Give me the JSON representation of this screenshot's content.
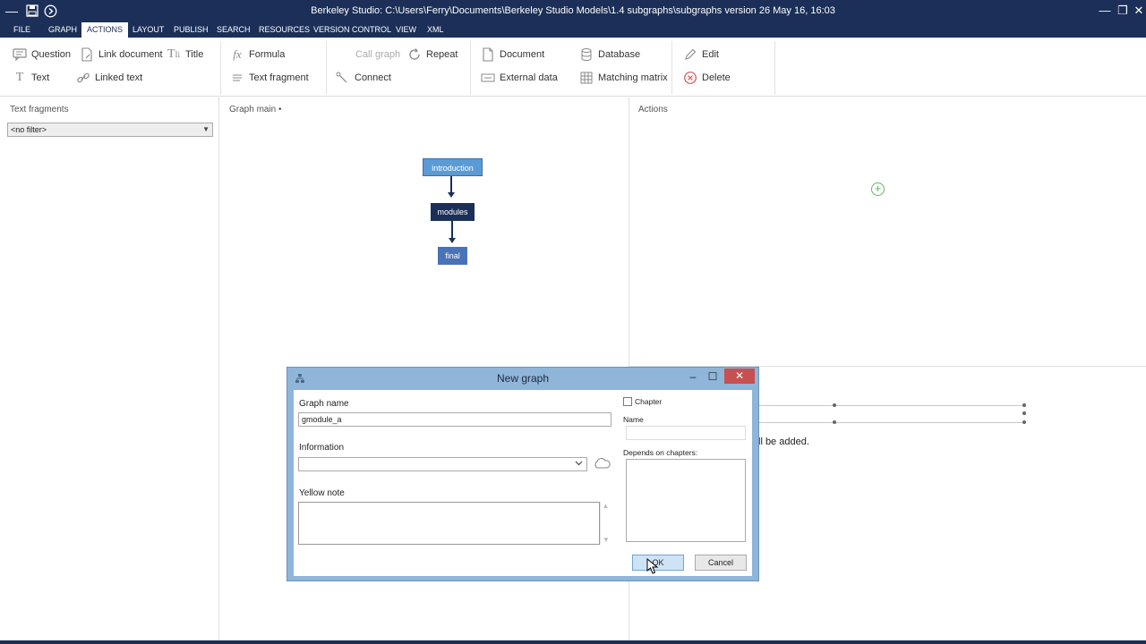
{
  "window": {
    "title": "Berkeley Studio: C:\\Users\\Ferry\\Documents\\Berkeley Studio Models\\1.4 subgraphs\\subgraphs version 26 May 16, 16:03",
    "controls": {
      "minimize": "—",
      "restore": "❐",
      "close": "✕"
    }
  },
  "quick_access": {
    "menu": "—",
    "save": "💾",
    "forward": "⊳"
  },
  "menu": {
    "tabs": [
      "FILE",
      "GRAPH",
      "ACTIONS",
      "LAYOUT",
      "PUBLISH",
      "SEARCH",
      "RESOURCES",
      "VERSION CONTROL",
      "VIEW",
      "XML"
    ],
    "active": "ACTIONS"
  },
  "ribbon": {
    "question": "Question",
    "link_document": "Link document",
    "title": "Title",
    "text": "Text",
    "linked_text": "Linked text",
    "formula": "Formula",
    "text_fragment": "Text fragment",
    "call_graph": "Call graph",
    "repeat": "Repeat",
    "connect": "Connect",
    "document": "Document",
    "database": "Database",
    "external_data": "External data",
    "matching_matrix": "Matching matrix",
    "edit": "Edit",
    "delete": "Delete"
  },
  "left_panel": {
    "title": "Text fragments",
    "filter_value": "<no filter>"
  },
  "graph_panel": {
    "title": "Graph main •",
    "nodes": {
      "introduction": "introduction",
      "modules": "modules",
      "final": "final"
    }
  },
  "actions_panel": {
    "title": "Actions",
    "add_symbol": "+"
  },
  "background_text": "ll be added.",
  "dialog": {
    "title": "New graph",
    "controls": {
      "minimize": "–",
      "maximize": "☐",
      "close": "✕"
    },
    "graph_name_label": "Graph name",
    "graph_name_value": "gmodule_a",
    "information_label": "Information",
    "information_value": "",
    "yellow_note_label": "Yellow note",
    "yellow_note_value": "",
    "chapter_label": "Chapter",
    "chapter_checked": false,
    "name_label": "Name",
    "name_value": "",
    "depends_label": "Depends on chapters:",
    "ok_label": "OK",
    "cancel_label": "Cancel"
  },
  "colors": {
    "titlebar": "#1b2f58",
    "node_introduction": "#5b9bd5",
    "node_modules": "#1b2f58",
    "node_final": "#4a72b8",
    "dialog_frame": "#8fb5d9",
    "close_red": "#c75050",
    "add_green": "#5cb85c"
  }
}
